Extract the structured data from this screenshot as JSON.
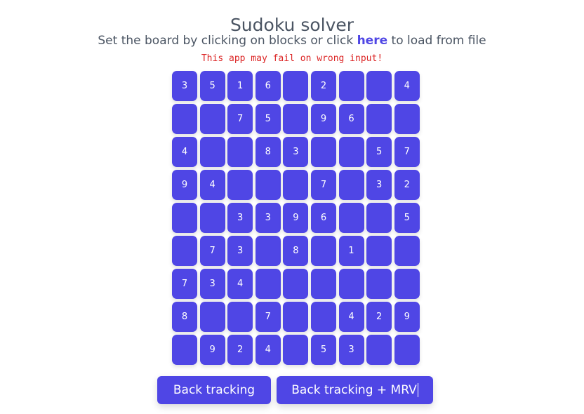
{
  "header": {
    "title": "Sudoku solver",
    "subtitle_before": "Set the board by clicking on blocks or click ",
    "subtitle_link": "here",
    "subtitle_after": " to load from file",
    "warning": "This app may fail on wrong input!"
  },
  "colors": {
    "accent": "#4f46e5",
    "warning": "#dc2626",
    "text": "#4b5563"
  },
  "board": [
    [
      "3",
      "5",
      "1",
      "6",
      "",
      "2",
      "",
      "",
      "4"
    ],
    [
      "",
      "",
      "7",
      "5",
      "",
      "9",
      "6",
      "",
      ""
    ],
    [
      "4",
      "",
      "",
      "8",
      "3",
      "",
      "",
      "5",
      "7"
    ],
    [
      "9",
      "4",
      "",
      "",
      "",
      "7",
      "",
      "3",
      "2"
    ],
    [
      "",
      "",
      "3",
      "3",
      "9",
      "6",
      "",
      "",
      "5"
    ],
    [
      "",
      "7",
      "3",
      "",
      "8",
      "",
      "1",
      "",
      ""
    ],
    [
      "7",
      "3",
      "4",
      "",
      "",
      "",
      "",
      "",
      ""
    ],
    [
      "8",
      "",
      "",
      "7",
      "",
      "",
      "4",
      "2",
      "9"
    ],
    [
      "",
      "9",
      "2",
      "4",
      "",
      "5",
      "3",
      "",
      ""
    ]
  ],
  "actions": {
    "backtracking_label": "Back tracking",
    "backtracking_mrv_label": "Back tracking + MRV"
  }
}
